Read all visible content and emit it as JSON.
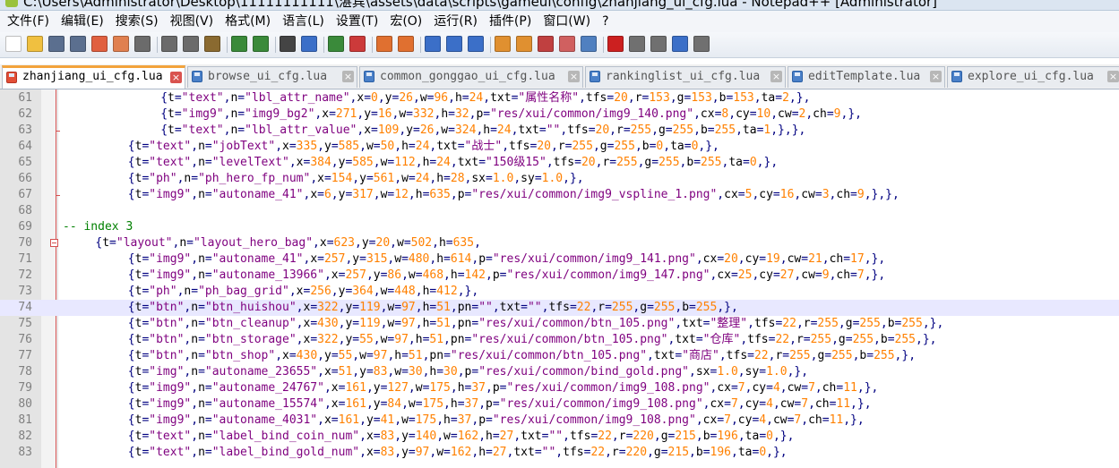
{
  "window": {
    "title": "C:\\Users\\Administrator\\Desktop\\11111111111\\湛宾\\assets\\data\\scripts\\gameui\\config\\zhanjiang_ui_cfg.lua - Notepad++ [Administrator]"
  },
  "menu": [
    "文件(F)",
    "编辑(E)",
    "搜索(S)",
    "视图(V)",
    "格式(M)",
    "语言(L)",
    "设置(T)",
    "宏(O)",
    "运行(R)",
    "插件(P)",
    "窗口(W)",
    "?"
  ],
  "toolbar_icons": [
    "new-file-icon",
    "open-file-icon",
    "save-icon",
    "save-all-icon",
    "close-icon",
    "close-all-icon",
    "print-icon",
    "cut-icon",
    "copy-icon",
    "paste-icon",
    "undo-icon",
    "redo-icon",
    "find-icon",
    "replace-icon",
    "zoom-in-icon",
    "zoom-out-icon",
    "sync-vertical-icon",
    "sync-horizontal-icon",
    "word-wrap-icon",
    "show-all-chars-icon",
    "indent-guide-icon",
    "user-lang-icon",
    "doc-map-icon",
    "function-list-icon",
    "folder-workspace-icon",
    "monitoring-icon",
    "record-macro-icon",
    "stop-record-icon",
    "play-macro-icon",
    "run-macro-multiple-icon",
    "save-macro-icon"
  ],
  "tabs": [
    {
      "label": "zhanjiang_ui_cfg.lua",
      "active": true
    },
    {
      "label": "browse_ui_cfg.lua",
      "active": false
    },
    {
      "label": "common_gonggao_ui_cfg.lua",
      "active": false
    },
    {
      "label": "rankinglist_ui_cfg.lua",
      "active": false
    },
    {
      "label": "editTemplate.lua",
      "active": false
    },
    {
      "label": "explore_ui_cfg.lua",
      "active": false
    }
  ],
  "editor": {
    "current_line": 74,
    "lines": [
      {
        "n": "61",
        "indent": 12,
        "text": "{t=\"text\",n=\"lbl_attr_name\",x=0,y=26,w=96,h=24,txt=\"属性名称\",tfs=20,r=153,g=153,b=153,ta=2,},"
      },
      {
        "n": "62",
        "indent": 12,
        "text": "{t=\"img9\",n=\"img9_bg2\",x=271,y=16,w=332,h=32,p=\"res/xui/common/img9_140.png\",cx=8,cy=10,cw=2,ch=9,},"
      },
      {
        "n": "63",
        "indent": 12,
        "text": "{t=\"text\",n=\"lbl_attr_value\",x=109,y=26,w=324,h=24,txt=\"\",tfs=20,r=255,g=255,b=255,ta=1,},},"
      },
      {
        "n": "64",
        "indent": 8,
        "text": "{t=\"text\",n=\"jobText\",x=335,y=585,w=50,h=24,txt=\"战士\",tfs=20,r=255,g=255,b=0,ta=0,},"
      },
      {
        "n": "65",
        "indent": 8,
        "text": "{t=\"text\",n=\"levelText\",x=384,y=585,w=112,h=24,txt=\"150级15\",tfs=20,r=255,g=255,b=255,ta=0,},"
      },
      {
        "n": "66",
        "indent": 8,
        "text": "{t=\"ph\",n=\"ph_hero_fp_num\",x=154,y=561,w=24,h=28,sx=1.0,sy=1.0,},"
      },
      {
        "n": "67",
        "indent": 8,
        "text": "{t=\"img9\",n=\"autoname_41\",x=6,y=317,w=12,h=635,p=\"res/xui/common/img9_vspline_1.png\",cx=5,cy=16,cw=3,ch=9,},},"
      },
      {
        "n": "68",
        "indent": 0,
        "text": ""
      },
      {
        "n": "69",
        "indent": 0,
        "text": "-- index 3"
      },
      {
        "n": "70",
        "indent": 4,
        "text": "{t=\"layout\",n=\"layout_hero_bag\",x=623,y=20,w=502,h=635,"
      },
      {
        "n": "71",
        "indent": 8,
        "text": "{t=\"img9\",n=\"autoname_41\",x=257,y=315,w=480,h=614,p=\"res/xui/common/img9_141.png\",cx=20,cy=19,cw=21,ch=17,},"
      },
      {
        "n": "72",
        "indent": 8,
        "text": "{t=\"img9\",n=\"autoname_13966\",x=257,y=86,w=468,h=142,p=\"res/xui/common/img9_147.png\",cx=25,cy=27,cw=9,ch=7,},"
      },
      {
        "n": "73",
        "indent": 8,
        "text": "{t=\"ph\",n=\"ph_bag_grid\",x=256,y=364,w=448,h=412,},"
      },
      {
        "n": "74",
        "indent": 8,
        "text": "{t=\"btn\",n=\"btn_huishou\",x=322,y=119,w=97,h=51,pn=\"\",txt=\"\",tfs=22,r=255,g=255,b=255,},"
      },
      {
        "n": "75",
        "indent": 8,
        "text": "{t=\"btn\",n=\"btn_cleanup\",x=430,y=119,w=97,h=51,pn=\"res/xui/common/btn_105.png\",txt=\"整理\",tfs=22,r=255,g=255,b=255,},"
      },
      {
        "n": "76",
        "indent": 8,
        "text": "{t=\"btn\",n=\"btn_storage\",x=322,y=55,w=97,h=51,pn=\"res/xui/common/btn_105.png\",txt=\"仓库\",tfs=22,r=255,g=255,b=255,},"
      },
      {
        "n": "77",
        "indent": 8,
        "text": "{t=\"btn\",n=\"btn_shop\",x=430,y=55,w=97,h=51,pn=\"res/xui/common/btn_105.png\",txt=\"商店\",tfs=22,r=255,g=255,b=255,},"
      },
      {
        "n": "78",
        "indent": 8,
        "text": "{t=\"img\",n=\"autoname_23655\",x=51,y=83,w=30,h=30,p=\"res/xui/common/bind_gold.png\",sx=1.0,sy=1.0,},"
      },
      {
        "n": "79",
        "indent": 8,
        "text": "{t=\"img9\",n=\"autoname_24767\",x=161,y=127,w=175,h=37,p=\"res/xui/common/img9_108.png\",cx=7,cy=4,cw=7,ch=11,},"
      },
      {
        "n": "80",
        "indent": 8,
        "text": "{t=\"img9\",n=\"autoname_15574\",x=161,y=84,w=175,h=37,p=\"res/xui/common/img9_108.png\",cx=7,cy=4,cw=7,ch=11,},"
      },
      {
        "n": "81",
        "indent": 8,
        "text": "{t=\"img9\",n=\"autoname_4031\",x=161,y=41,w=175,h=37,p=\"res/xui/common/img9_108.png\",cx=7,cy=4,cw=7,ch=11,},"
      },
      {
        "n": "82",
        "indent": 8,
        "text": "{t=\"text\",n=\"label_bind_coin_num\",x=83,y=140,w=162,h=27,txt=\"\",tfs=22,r=220,g=215,b=196,ta=0,},"
      },
      {
        "n": "83",
        "indent": 8,
        "text": "{t=\"text\",n=\"label_bind_gold_num\",x=83,y=97,w=162,h=27,txt=\"\",tfs=22,r=220,g=215,b=196,ta=0,},"
      }
    ]
  },
  "colors": {
    "string": "#7f007f",
    "number": "#ff8000",
    "operator": "#000080",
    "comment": "#008000",
    "current_line_bg": "#e8e8ff",
    "active_tab_accent": "#f3a33b"
  }
}
